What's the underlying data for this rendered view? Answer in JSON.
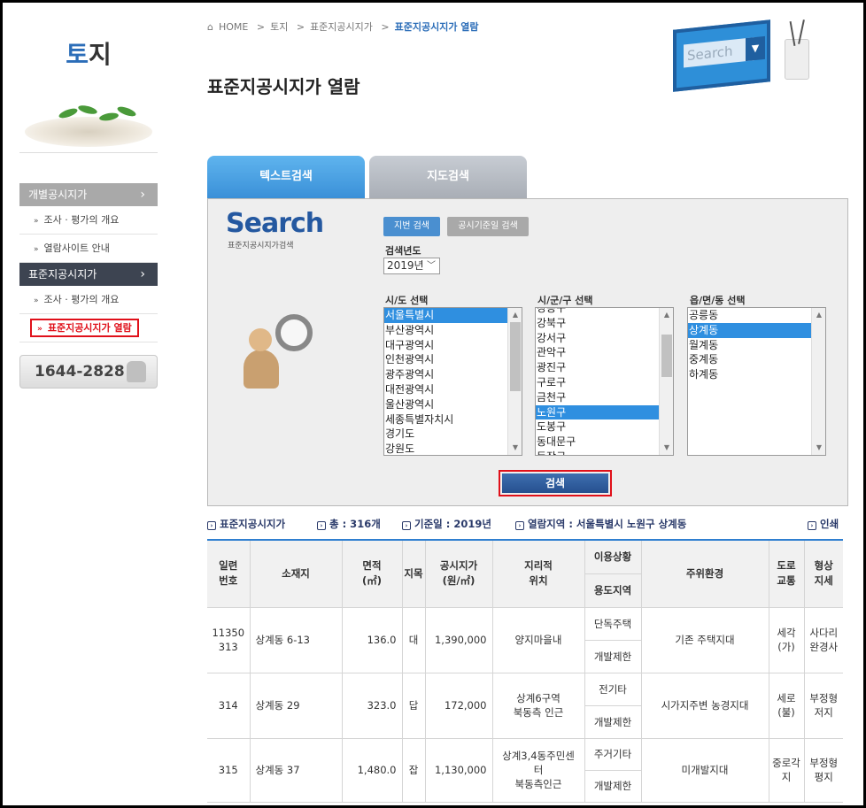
{
  "sidebar": {
    "title_accent": "토",
    "title_rest": "지",
    "menu": [
      {
        "label": "개별공시지가",
        "arrow": "›",
        "style": "gray"
      },
      {
        "label": "조사 · 평가의 개요",
        "type": "sub"
      },
      {
        "label": "열람사이트 안내",
        "type": "sub"
      },
      {
        "label": "표준지공시지가",
        "arrow": "›",
        "style": "dark"
      },
      {
        "label": "조사 · 평가의 개요",
        "type": "sub"
      },
      {
        "label": "표준지공시지가 열람",
        "type": "sub",
        "active": true
      }
    ],
    "phone": "1644-2828"
  },
  "breadcrumb": {
    "home": "HOME",
    "sep": ">",
    "items": [
      "토지",
      "표준지공시지가",
      "표준지공시지가 열람"
    ]
  },
  "page_title": "표준지공시지가 열람",
  "header_art": {
    "search_word": "Search",
    "drop_glyph": "▼"
  },
  "tabs": [
    {
      "label": "텍스트검색",
      "active": true
    },
    {
      "label": "지도검색",
      "active": false
    }
  ],
  "panel": {
    "logo": "Search",
    "logo_sub": "표준지공시지가검색",
    "btn_jibun": "지번 검색",
    "btn_date": "공시기준일 검색",
    "year_label": "검색년도",
    "year_value": "2019년",
    "sido_label": "시/도 선택",
    "sigungu_label": "시/군/구 선택",
    "emd_label": "읍/면/동 선택",
    "sido_options": [
      "서울특별시",
      "부산광역시",
      "대구광역시",
      "인천광역시",
      "광주광역시",
      "대전광역시",
      "울산광역시",
      "세종특별자치시",
      "경기도",
      "강원도"
    ],
    "sido_selected": 0,
    "sigungu_options": [
      "강동구",
      "강북구",
      "강서구",
      "관악구",
      "광진구",
      "구로구",
      "금천구",
      "노원구",
      "도봉구",
      "동대문구",
      "동작구"
    ],
    "sigungu_selected": 7,
    "emd_options": [
      "공릉동",
      "상계동",
      "월계동",
      "중계동",
      "하계동"
    ],
    "emd_selected": 1,
    "search_button": "검색"
  },
  "info": {
    "section": "표준지공시지가",
    "total": "총 : 316개",
    "base_date": "기준일 : 2019년",
    "region": "열람지역 : 서울특별시 노원구 상계동",
    "print": "인쇄"
  },
  "table": {
    "headers": {
      "serial": "일련\n번호",
      "location": "소재지",
      "area": "면적\n(㎡)",
      "jimok": "지목",
      "price": "공시지가\n(원/㎡)",
      "geo": "지리적\n위치",
      "usage": "이용상황",
      "zoning": "용도지역",
      "env": "주위환경",
      "road": "도로\n교통",
      "shape": "형상\n지세"
    },
    "rows": [
      {
        "serial": "11350\n313",
        "location": "상계동 6-13",
        "area": "136.0",
        "jimok": "대",
        "price": "1,390,000",
        "geo": "양지마을내",
        "usage": "단독주택",
        "zoning": "개발제한",
        "env": "기존 주택지대",
        "road": "세각\n(가)",
        "shape": "사다리\n완경사"
      },
      {
        "serial": "314",
        "location": "상계동 29",
        "area": "323.0",
        "jimok": "답",
        "price": "172,000",
        "geo": "상계6구역\n북동측 인근",
        "usage": "전기타",
        "zoning": "개발제한",
        "env": "시가지주변 농경지대",
        "road": "세로\n(불)",
        "shape": "부정형\n저지"
      },
      {
        "serial": "315",
        "location": "상계동 37",
        "area": "1,480.0",
        "jimok": "잡",
        "price": "1,130,000",
        "geo": "상계3,4동주민센\n터\n북동측인근",
        "usage": "주거기타",
        "zoning": "개발제한",
        "env": "미개발지대",
        "road": "중로각\n지",
        "shape": "부정형\n평지"
      }
    ]
  }
}
